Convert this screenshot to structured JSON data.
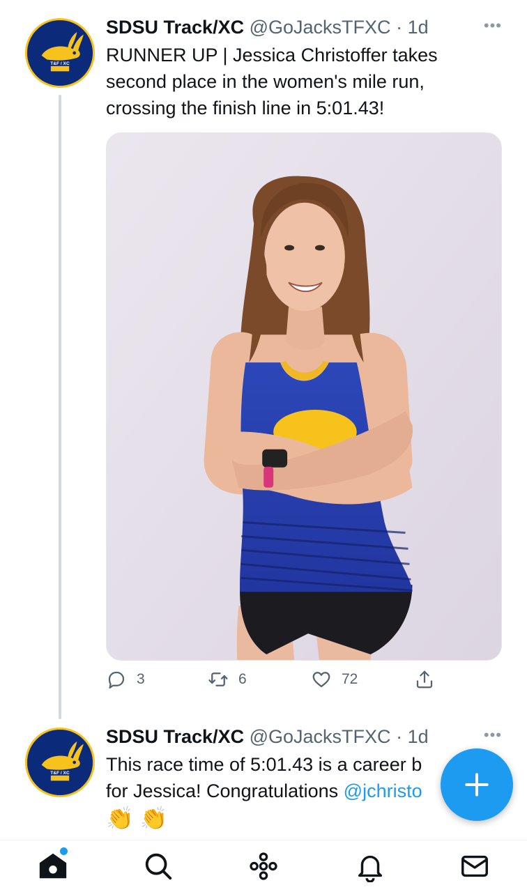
{
  "tweets": [
    {
      "display_name": "SDSU Track/XC",
      "handle": "@GoJacksTFXC",
      "separator": "·",
      "time": "1d",
      "more_label": "•••",
      "text_lines": [
        "RUNNER UP | Jessica Christoffer takes",
        "second place in the women's mile run,",
        "crossing the finish line in 5:01.43!"
      ],
      "counts": {
        "replies": "3",
        "retweets": "6",
        "likes": "72"
      },
      "avatar_text": "T&F / XC"
    },
    {
      "display_name": "SDSU Track/XC",
      "handle": "@GoJacksTFXC",
      "separator": "·",
      "time": "1d",
      "more_label": "•••",
      "line1": "This race time of 5:01.43 is a career b",
      "line2_text": "for Jessica! Congratulations ",
      "line2_mention": "@jchristo",
      "emoji": "👏 👏",
      "avatar_text": "T&F / XC"
    }
  ],
  "colors": {
    "accent": "#1d9bf0",
    "avatar_bg": "#0b2a7a",
    "avatar_ring": "#f6c21b",
    "text": "#0f1419",
    "muted": "#536471"
  },
  "icons": {
    "reply": "speech-bubble-icon",
    "retweet": "retweet-arrows-icon",
    "like": "heart-icon",
    "share": "share-upload-icon",
    "compose": "plus-icon",
    "nav": [
      "home-icon",
      "search-icon",
      "spaces-icon",
      "bell-icon",
      "mail-icon"
    ]
  }
}
